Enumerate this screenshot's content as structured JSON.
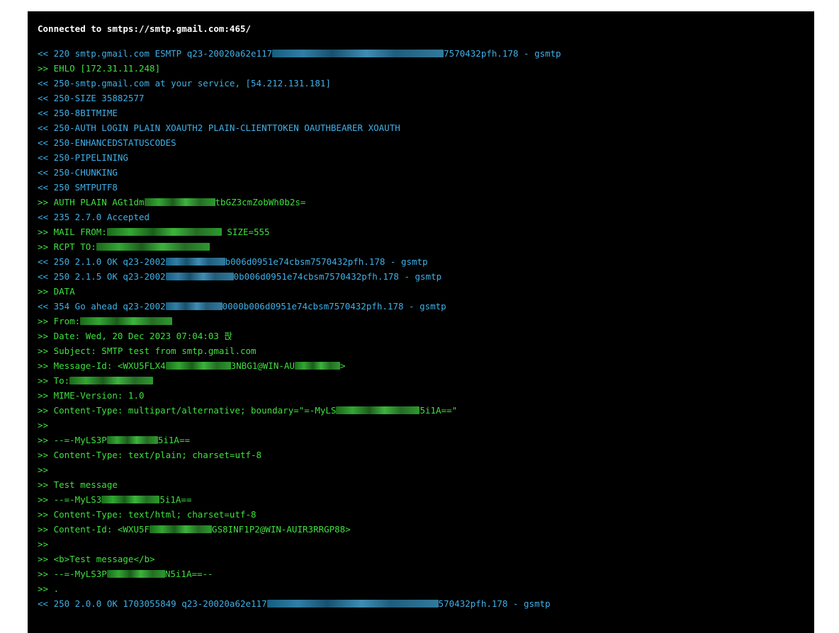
{
  "header": {
    "text": "Connected to smtps://smtp.gmail.com:465/"
  },
  "colors": {
    "incoming": "#3fb0e8",
    "outgoing": "#3fe03f",
    "background": "#000000",
    "header": "#ffffff"
  },
  "lines": [
    {
      "dir": "in",
      "pre": "<< 220 smtp.gmail.com ESMTP q23-20020a62e117",
      "post": "7570432pfh.178 - gsmtp"
    },
    {
      "dir": "out",
      "pre": ">> EHLO [172.31.11.248]"
    },
    {
      "dir": "in",
      "pre": "<< 250-smtp.gmail.com at your service, [54.212.131.181]"
    },
    {
      "dir": "in",
      "pre": "<< 250-SIZE 35882577"
    },
    {
      "dir": "in",
      "pre": "<< 250-8BITMIME"
    },
    {
      "dir": "in",
      "pre": "<< 250-AUTH LOGIN PLAIN XOAUTH2 PLAIN-CLIENTTOKEN OAUTHBEARER XOAUTH"
    },
    {
      "dir": "in",
      "pre": "<< 250-ENHANCEDSTATUSCODES"
    },
    {
      "dir": "in",
      "pre": "<< 250-PIPELINING"
    },
    {
      "dir": "in",
      "pre": "<< 250-CHUNKING"
    },
    {
      "dir": "in",
      "pre": "<< 250 SMTPUTF8"
    },
    {
      "dir": "out",
      "pre": ">> AUTH PLAIN AGt1dm",
      "post": "tbGZ3cmZobWh0b2s="
    },
    {
      "dir": "in",
      "pre": "<< 235 2.7.0 Accepted"
    },
    {
      "dir": "out",
      "pre": ">> MAIL FROM:",
      "post": " SIZE=555"
    },
    {
      "dir": "out",
      "pre": ">> RCPT TO:",
      "post": ""
    },
    {
      "dir": "in",
      "pre": "<< 250 2.1.0 OK q23-2002",
      "post": "b006d0951e74cbsm7570432pfh.178 - gsmtp"
    },
    {
      "dir": "in",
      "pre": "<< 250 2.1.5 OK q23-2002",
      "post": "0b006d0951e74cbsm7570432pfh.178 - gsmtp"
    },
    {
      "dir": "out",
      "pre": ">> DATA"
    },
    {
      "dir": "in",
      "pre": "<< 354 Go ahead q23-2002",
      "post": "0000b006d0951e74cbsm7570432pfh.178 - gsmtp"
    },
    {
      "dir": "out",
      "pre": ">> From:",
      "post": ""
    },
    {
      "dir": "out",
      "pre": ">> Date: Wed, 20 Dec 2023 07:04:03 팑"
    },
    {
      "dir": "out",
      "pre": ">> Subject: SMTP test from smtp.gmail.com"
    },
    {
      "dir": "out",
      "pre": ">> Message-Id: <WXU5FLX4",
      "post": "3NBG1@WIN-AU",
      "tail": ">"
    },
    {
      "dir": "out",
      "pre": ">> To:",
      "post": ""
    },
    {
      "dir": "out",
      "pre": ">> MIME-Version: 1.0"
    },
    {
      "dir": "out",
      "pre": ">> Content-Type: multipart/alternative; boundary=\"=-MyLS",
      "post": "5i1A==\""
    },
    {
      "dir": "out",
      "pre": ">>"
    },
    {
      "dir": "out",
      "pre": ">> --=-MyLS3P",
      "post": "5i1A=="
    },
    {
      "dir": "out",
      "pre": ">> Content-Type: text/plain; charset=utf-8"
    },
    {
      "dir": "out",
      "pre": ">>"
    },
    {
      "dir": "out",
      "pre": ">> Test message"
    },
    {
      "dir": "out",
      "pre": ">> --=-MyLS3",
      "post": "5i1A=="
    },
    {
      "dir": "out",
      "pre": ">> Content-Type: text/html; charset=utf-8"
    },
    {
      "dir": "out",
      "pre": ">> Content-Id: <WXU5F",
      "post": "GS8INF1P2@WIN-AUIR3RRGP88>"
    },
    {
      "dir": "out",
      "pre": ">>"
    },
    {
      "dir": "out",
      "pre": ">> <b>Test message</b>"
    },
    {
      "dir": "out",
      "pre": ">> --=-MyLS3P",
      "post": "N5i1A==--"
    },
    {
      "dir": "out",
      "pre": ">> ."
    },
    {
      "dir": "in",
      "pre": "<< 250 2.0.0 OK 1703055849 q23-20020a62e117",
      "post": "570432pfh.178 - gsmtp"
    }
  ]
}
